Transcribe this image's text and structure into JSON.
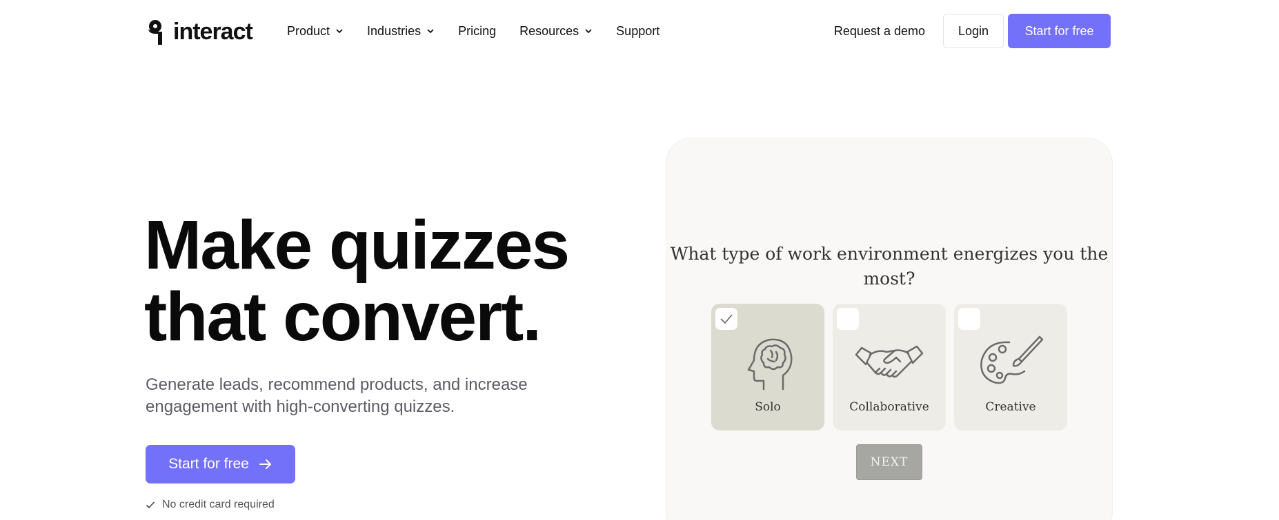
{
  "brand": {
    "name": "interact"
  },
  "nav": {
    "menu": [
      {
        "label": "Product",
        "has_dropdown": true
      },
      {
        "label": "Industries",
        "has_dropdown": true
      },
      {
        "label": "Pricing",
        "has_dropdown": false
      },
      {
        "label": "Resources",
        "has_dropdown": true
      },
      {
        "label": "Support",
        "has_dropdown": false
      }
    ],
    "demo_label": "Request a demo",
    "login_label": "Login",
    "start_label": "Start for free"
  },
  "hero": {
    "title_line1": "Make quizzes",
    "title_line2": "that convert.",
    "subtitle": "Generate leads, recommend products, and increase engagement with high-converting quizzes.",
    "cta_label": "Start for free",
    "note": "No credit card required"
  },
  "quiz": {
    "question": "What type of work environment energizes you the most?",
    "options": [
      {
        "label": "Solo",
        "icon": "head-brain-icon",
        "selected": true
      },
      {
        "label": "Collaborative",
        "icon": "handshake-icon",
        "selected": false
      },
      {
        "label": "Creative",
        "icon": "paint-palette-icon",
        "selected": false
      }
    ],
    "next_label": "NEXT"
  },
  "colors": {
    "accent": "#7370fa",
    "card_bg": "#f9f8f6",
    "option_bg": "#eeece6",
    "option_selected_bg": "#dcdbd0",
    "next_bg": "#a6a6a3"
  }
}
